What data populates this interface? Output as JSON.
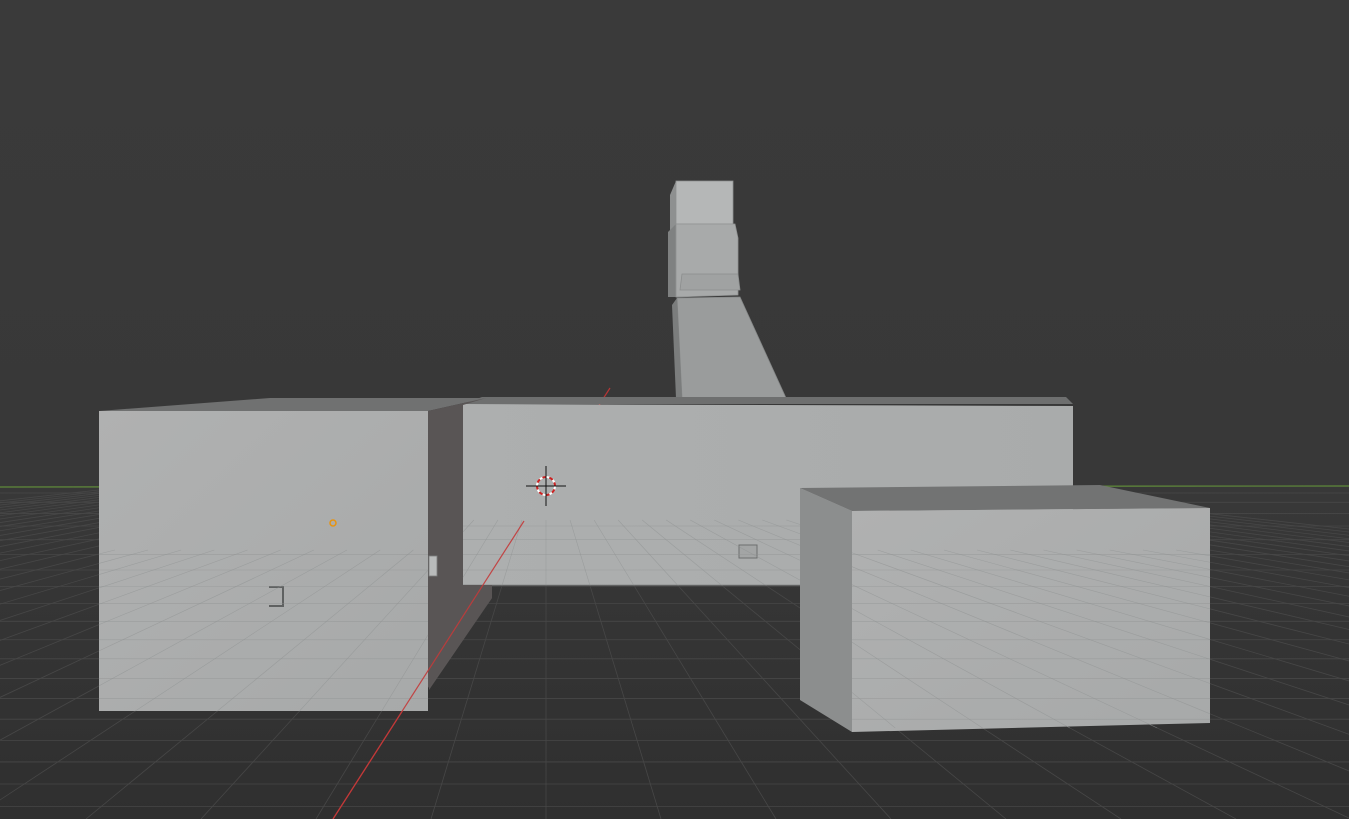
{
  "viewport": {
    "name": "3D Viewport",
    "background_color": "#393939",
    "floor_grid_color": "#474747",
    "x_axis_color": "#c0393b",
    "y_axis_color": "#6a9a3a",
    "origin_color": "#f0a020"
  },
  "scene_objects": [
    {
      "name": "left-box"
    },
    {
      "name": "middle-long-box"
    },
    {
      "name": "right-box"
    },
    {
      "name": "chute"
    }
  ],
  "cursor": {
    "name": "3d-cursor"
  }
}
